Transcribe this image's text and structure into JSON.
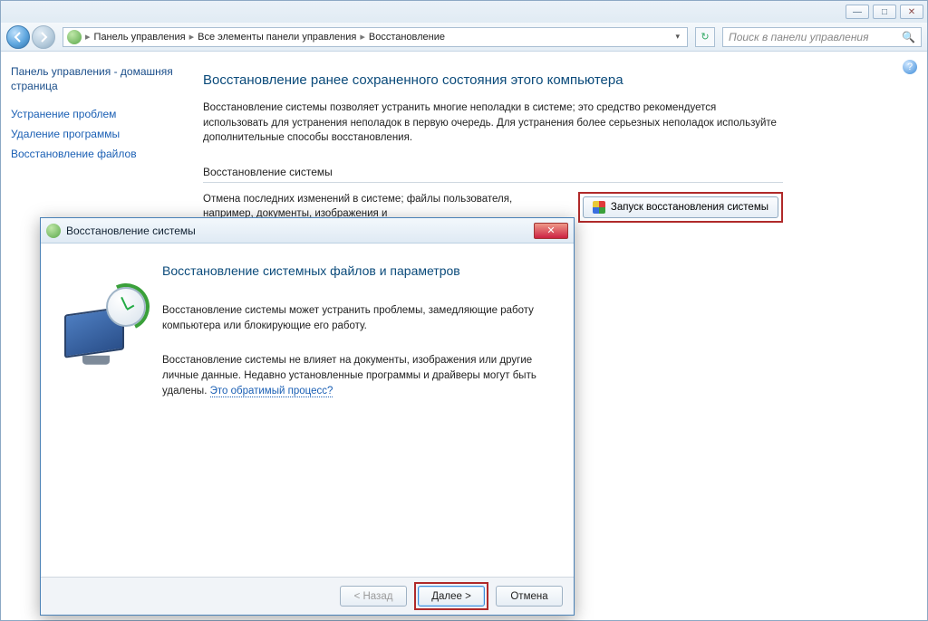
{
  "titlebar": {
    "min": "—",
    "max": "□",
    "close": "✕"
  },
  "breadcrumb": {
    "seg1": "Панель управления",
    "seg2": "Все элементы панели управления",
    "seg3": "Восстановление"
  },
  "search": {
    "placeholder": "Поиск в панели управления"
  },
  "sidebar": {
    "home": "Панель управления - домашняя страница",
    "link1": "Устранение проблем",
    "link2": "Удаление программы",
    "link3": "Восстановление файлов"
  },
  "page": {
    "title": "Восстановление ранее сохраненного состояния этого компьютера",
    "desc": "Восстановление системы позволяет устранить многие неполадки в системе; это средство рекомендуется использовать для устранения неполадок в первую очередь. Для устранения более серьезных неполадок используйте дополнительные способы восстановления.",
    "section_label": "Восстановление системы",
    "section_text": "Отмена последних изменений в системе; файлы пользователя, например, документы, изображения и",
    "launch_btn": "Запуск восстановления системы"
  },
  "dialog": {
    "title": "Восстановление системы",
    "heading": "Восстановление системных файлов и параметров",
    "p1": "Восстановление системы может устранить проблемы, замедляющие работу компьютера или блокирующие его работу.",
    "p2_a": "Восстановление системы не влияет на документы, изображения или другие личные данные. Недавно установленные программы и драйверы могут быть удалены. ",
    "p2_link": "Это обратимый процесс?",
    "btn_back": "< Назад",
    "btn_next": "Далее >",
    "btn_cancel": "Отмена"
  }
}
